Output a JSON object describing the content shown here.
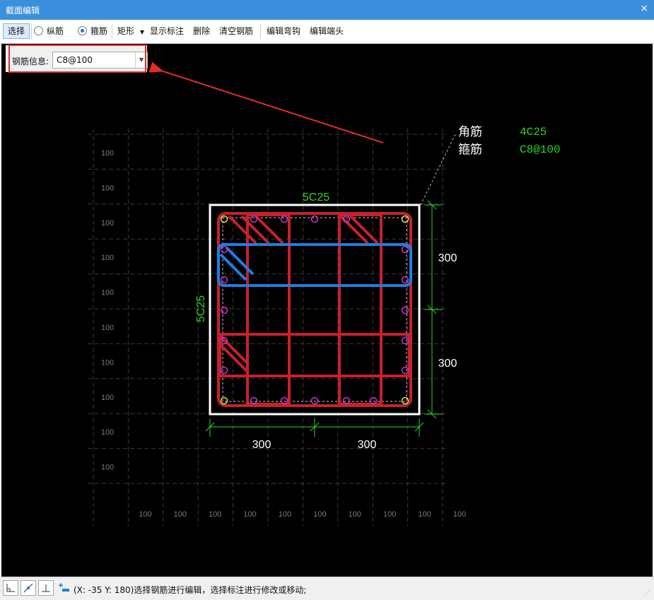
{
  "window": {
    "title": "截面编辑",
    "close_glyph": "×"
  },
  "toolbar": {
    "select": "选择",
    "longitudinal": "纵筋",
    "stirrup": "箍筋",
    "shape": "矩形",
    "show_label": "显示标注",
    "delete": "删除",
    "clear": "清空钢筋",
    "edit_hook": "编辑弯钩",
    "edit_end": "编辑端头",
    "selected_mode": "stirrup"
  },
  "rebar_info": {
    "label": "钢筋信息:",
    "value": "C8@100"
  },
  "drawing": {
    "grid_left_labels": [
      "100",
      "100",
      "100",
      "100",
      "100",
      "100",
      "100",
      "100",
      "100",
      "100"
    ],
    "grid_bottom_labels": [
      "100",
      "100",
      "100",
      "100",
      "100",
      "100",
      "100",
      "100",
      "100",
      "100"
    ],
    "top_rebar": "5C25",
    "side_rebar": "5C25",
    "legend": [
      {
        "name": "角筋",
        "value": "4C25"
      },
      {
        "name": "箍筋",
        "value": "C8@100"
      }
    ],
    "dim_right": [
      "300",
      "300"
    ],
    "dim_bottom": [
      "300",
      "300"
    ],
    "colors": {
      "stirrup": "#c8202c",
      "selected": "#1e7fe0",
      "dim": "#2bd42b",
      "rebar_dot": "#cc33cc",
      "corner_dot": "#e8e050"
    }
  },
  "status": {
    "text": "(X: -35 Y: 180)选择钢筋进行编辑，选择标注进行修改或移动;"
  },
  "icons": [
    "orthogonal-icon",
    "snap-line-icon",
    "perpendicular-icon",
    "add-dimension-icon"
  ]
}
